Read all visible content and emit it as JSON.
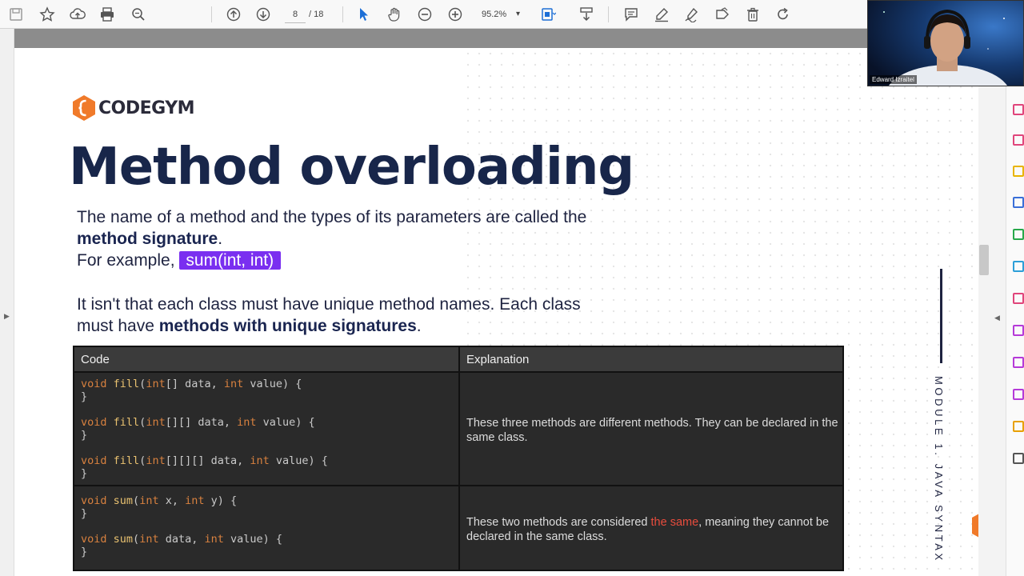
{
  "toolbar": {
    "current_page": "8",
    "total_pages": "/ 18",
    "zoom": "95.2%"
  },
  "slide": {
    "logo_text": "CODEGYM",
    "title": "Method overloading",
    "para1_line1": "The name of a method and the types of its parameters are called the",
    "para1_bold": "method signature",
    "para1_dot": ".",
    "para2_prefix": "For example, ",
    "para2_highlight": "sum(int, int)",
    "para3_line1": "It isn't that each class must have unique method names. Each class",
    "para3_prefix": "must have ",
    "para3_bold": "methods with unique signatures",
    "para3_dot": ".",
    "side_label": "MODULE 1. JAVA SYNTAX"
  },
  "table": {
    "headers": [
      "Code",
      "Explanation"
    ],
    "row1_explanation": "These three methods are different methods. They can be declared in the same class.",
    "row2_expl_prefix": "These two methods are considered ",
    "row2_expl_red": "the same",
    "row2_expl_suffix": ", meaning they cannot be declared in the same class."
  },
  "webcam": {
    "name": "Edward Izraitel"
  },
  "colors": {
    "title": "#18264a",
    "highlight": "#7a2ff0",
    "brand_orange": "#f07a2a",
    "table_bg": "#2a2a2a",
    "keyword": "#d8813f",
    "red_text": "#e84c3d"
  }
}
